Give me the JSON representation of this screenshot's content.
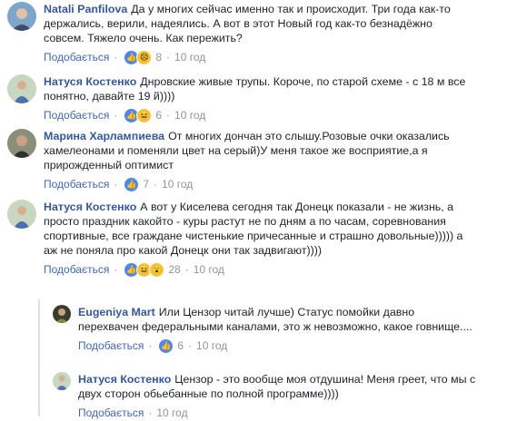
{
  "labels": {
    "like": "Подобається",
    "dot": "·"
  },
  "comments": [
    {
      "author": "Natali Panfilova",
      "text": "Да у многих сейчас именно так и происходит. Три года как-то держались, верили, надеялись. А вот в этот Новый год как-то безнадёжно совсем. Тяжело очень. Как пережить?",
      "reactions": [
        "like-icon",
        "sad-icon"
      ],
      "count": "8",
      "time": "10 год"
    },
    {
      "author": "Натуся Костенко",
      "text": "Днровские живые трупы. Короче, по старой схеме - с 18 м все понятно, давайте 19 й))))",
      "reactions": [
        "like-icon",
        "haha-icon"
      ],
      "count": "6",
      "time": "10 год"
    },
    {
      "author": "Марина Харлампиева",
      "text": "От многих дончан это слышу.Розовые очки оказались хамелеонами и поменяли цвет на серый)У меня такое же восприятие,а я прирожденный оптимист",
      "reactions": [
        "like-icon"
      ],
      "count": "7",
      "time": "10 год"
    },
    {
      "author": "Натуся Костенко",
      "text": "А вот у Киселева сегодня так Донецк показали - не жизнь, а просто праздник какойто - куры растут не по дням а по часам, соревнования спортивные, все граждане чистенькие причесанные и страшно довольные))))) а аж не поняла про какой Донецк они так задвигают))))",
      "reactions": [
        "like-icon",
        "haha-icon",
        "wow-icon"
      ],
      "count": "28",
      "time": "10 год"
    }
  ],
  "replies": [
    {
      "author": "Eugeniya Mart",
      "text": "Или Цензор читай лучше) Статус помойки давно перехвачен федеральными каналами, это ж невозможно, какое говнище....",
      "reactions": [
        "like-icon"
      ],
      "count": "6",
      "time": "10 год"
    },
    {
      "author": "Натуся Костенко",
      "text": "Цензор - это вообще моя отдушина! Меня греет, что мы с двух сторон обьебанные по полной программе))))",
      "reactions": [],
      "count": "",
      "time": "10 год"
    }
  ],
  "colors": {
    "link": "#365899",
    "like": "#4267b2",
    "meta": "#90949c",
    "text": "#1d2129"
  }
}
